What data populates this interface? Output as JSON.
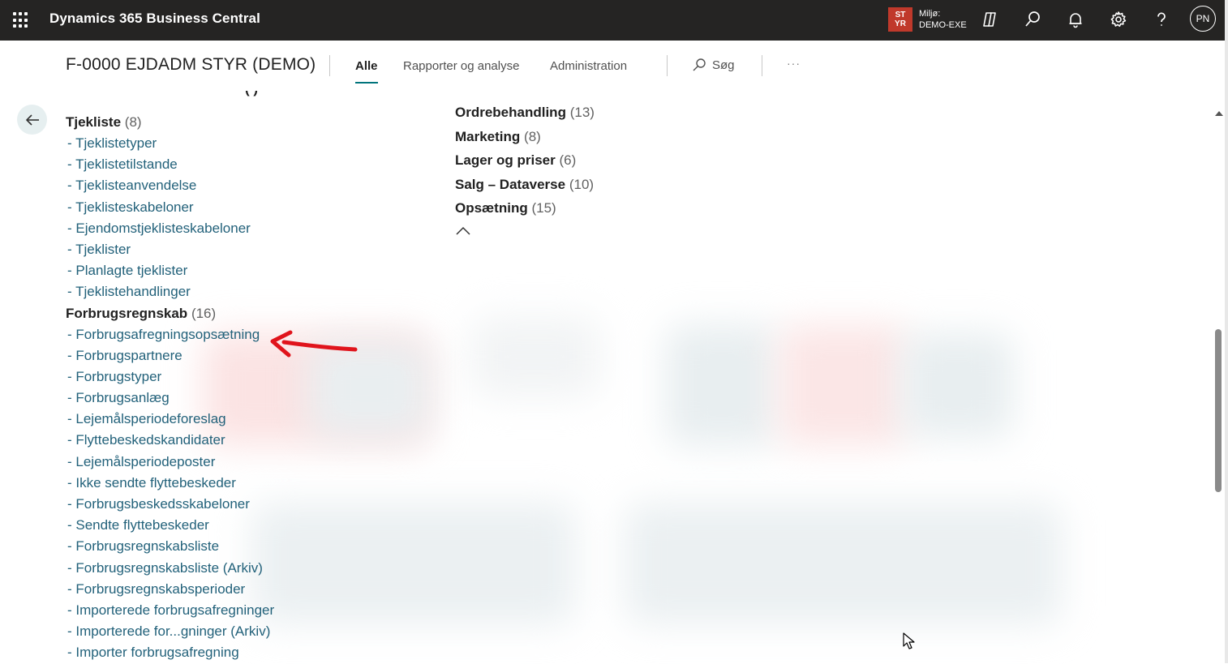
{
  "suitebar": {
    "app_title": "Dynamics 365 Business Central",
    "env_badge_line1": "ST",
    "env_badge_line2": "YR",
    "env_label": "Miljø:",
    "env_name": "DEMO-EXE",
    "avatar_initials": "PN",
    "icons": [
      "waffle-icon",
      "copilot-icon",
      "search-icon",
      "bell-icon",
      "gear-icon",
      "help-icon"
    ]
  },
  "header": {
    "company": "F-0000 EJDADM STYR (DEMO)",
    "tabs": [
      {
        "label": "Alle",
        "active": true
      },
      {
        "label": "Rapporter og analyse",
        "active": false
      },
      {
        "label": "Administration",
        "active": false
      }
    ],
    "search_label": "Søg",
    "more_label": "···"
  },
  "left_column": {
    "cutoff_text": "(  )",
    "groups": [
      {
        "title": "Tjekliste",
        "count": "(8)",
        "items": [
          "- Tjeklistetyper",
          "- Tjeklistetilstande",
          "- Tjeklisteanvendelse",
          "- Tjeklisteskabeloner",
          "- Ejendomstjeklisteskabeloner",
          "- Tjeklister",
          "- Planlagte tjeklister",
          "- Tjeklistehandlinger"
        ]
      },
      {
        "title": "Forbrugsregnskab",
        "count": "(16)",
        "items": [
          "- Forbrugsafregningsopsætning",
          "- Forbrugspartnere",
          "- Forbrugstyper",
          "- Forbrugsanlæg",
          "- Lejemålsperiodeforeslag",
          "- Flyttebeskedskandidater",
          "- Lejemålsperiodeposter",
          "- Ikke sendte flyttebeskeder",
          "- Forbrugsbeskedsskabeloner",
          "- Sendte flyttebeskeder",
          "- Forbrugsregnskabsliste",
          "- Forbrugsregnskabsliste (Arkiv)",
          "- Forbrugsregnskabsperioder",
          "- Importerede forbrugsafregninger",
          "- Importerede for...gninger (Arkiv)",
          "- Importer forbrugsafregning"
        ]
      }
    ]
  },
  "right_column": {
    "groups": [
      {
        "title": "Ordrebehandling",
        "count": "(13)"
      },
      {
        "title": "Marketing",
        "count": "(8)"
      },
      {
        "title": "Lager og priser",
        "count": "(6)"
      },
      {
        "title": "Salg – Dataverse",
        "count": "(10)"
      },
      {
        "title": "Opsætning",
        "count": "(15)"
      }
    ]
  },
  "colors": {
    "suitebar_bg": "#252423",
    "accent": "#00747c",
    "link": "#22617a",
    "env_badge": "#c0392b",
    "annotation_arrow": "#e0141c"
  }
}
